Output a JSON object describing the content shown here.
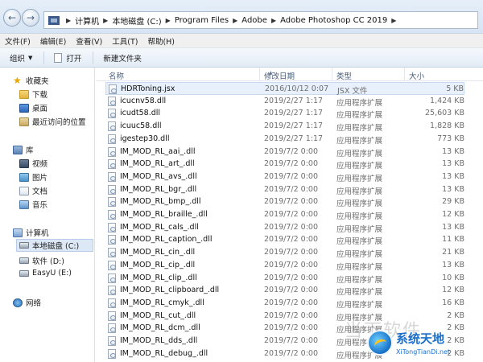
{
  "address": {
    "crumbs": [
      "计算机",
      "本地磁盘 (C:)",
      "Program Files",
      "Adobe",
      "Adobe Photoshop CC 2019"
    ]
  },
  "menu": [
    "文件(F)",
    "编辑(E)",
    "查看(V)",
    "工具(T)",
    "帮助(H)"
  ],
  "toolbar": {
    "organize": "组织",
    "open": "打开",
    "new_folder": "新建文件夹"
  },
  "sidebar": {
    "favorites": "收藏夹",
    "download": "下载",
    "desktop": "桌面",
    "recent": "最近访问的位置",
    "library": "库",
    "video": "视频",
    "pictures": "图片",
    "documents": "文档",
    "music": "音乐",
    "computer": "计算机",
    "drive_c": "本地磁盘 (C:)",
    "drive_d": "软件 (D:)",
    "drive_e": "EasyU (E:)",
    "network": "网络"
  },
  "columns": {
    "name": "名称",
    "date": "修改日期",
    "type": "类型",
    "size": "大小"
  },
  "files": [
    {
      "name": "HDRToning.jsx",
      "date": "2016/10/12 0:07",
      "type": "JSX 文件",
      "size": "5 KB"
    },
    {
      "name": "icucnv58.dll",
      "date": "2019/2/27 1:17",
      "type": "应用程序扩展",
      "size": "1,424 KB"
    },
    {
      "name": "icudt58.dll",
      "date": "2019/2/27 1:17",
      "type": "应用程序扩展",
      "size": "25,603 KB"
    },
    {
      "name": "icuuc58.dll",
      "date": "2019/2/27 1:17",
      "type": "应用程序扩展",
      "size": "1,828 KB"
    },
    {
      "name": "igestep30.dll",
      "date": "2019/2/27 1:17",
      "type": "应用程序扩展",
      "size": "773 KB"
    },
    {
      "name": "IM_MOD_RL_aai_.dll",
      "date": "2019/7/2 0:00",
      "type": "应用程序扩展",
      "size": "13 KB"
    },
    {
      "name": "IM_MOD_RL_art_.dll",
      "date": "2019/7/2 0:00",
      "type": "应用程序扩展",
      "size": "13 KB"
    },
    {
      "name": "IM_MOD_RL_avs_.dll",
      "date": "2019/7/2 0:00",
      "type": "应用程序扩展",
      "size": "13 KB"
    },
    {
      "name": "IM_MOD_RL_bgr_.dll",
      "date": "2019/7/2 0:00",
      "type": "应用程序扩展",
      "size": "13 KB"
    },
    {
      "name": "IM_MOD_RL_bmp_.dll",
      "date": "2019/7/2 0:00",
      "type": "应用程序扩展",
      "size": "29 KB"
    },
    {
      "name": "IM_MOD_RL_braille_.dll",
      "date": "2019/7/2 0:00",
      "type": "应用程序扩展",
      "size": "12 KB"
    },
    {
      "name": "IM_MOD_RL_cals_.dll",
      "date": "2019/7/2 0:00",
      "type": "应用程序扩展",
      "size": "13 KB"
    },
    {
      "name": "IM_MOD_RL_caption_.dll",
      "date": "2019/7/2 0:00",
      "type": "应用程序扩展",
      "size": "11 KB"
    },
    {
      "name": "IM_MOD_RL_cin_.dll",
      "date": "2019/7/2 0:00",
      "type": "应用程序扩展",
      "size": "21 KB"
    },
    {
      "name": "IM_MOD_RL_cip_.dll",
      "date": "2019/7/2 0:00",
      "type": "应用程序扩展",
      "size": "13 KB"
    },
    {
      "name": "IM_MOD_RL_clip_.dll",
      "date": "2019/7/2 0:00",
      "type": "应用程序扩展",
      "size": "10 KB"
    },
    {
      "name": "IM_MOD_RL_clipboard_.dll",
      "date": "2019/7/2 0:00",
      "type": "应用程序扩展",
      "size": "12 KB"
    },
    {
      "name": "IM_MOD_RL_cmyk_.dll",
      "date": "2019/7/2 0:00",
      "type": "应用程序扩展",
      "size": "16 KB"
    },
    {
      "name": "IM_MOD_RL_cut_.dll",
      "date": "2019/7/2 0:00",
      "type": "应用程序扩展",
      "size": "2 KB"
    },
    {
      "name": "IM_MOD_RL_dcm_.dll",
      "date": "2019/7/2 0:00",
      "type": "应用程序扩展",
      "size": "2 KB"
    },
    {
      "name": "IM_MOD_RL_dds_.dll",
      "date": "2019/7/2 0:00",
      "type": "应用程序扩展",
      "size": "2 KB"
    },
    {
      "name": "IM_MOD_RL_debug_.dll",
      "date": "2019/7/2 0:00",
      "type": "应用程序扩展",
      "size": "2 KB"
    }
  ],
  "watermark": {
    "faint": "当下软件",
    "title": "系统天地",
    "subtitle": "XiTongTianDi.net"
  }
}
